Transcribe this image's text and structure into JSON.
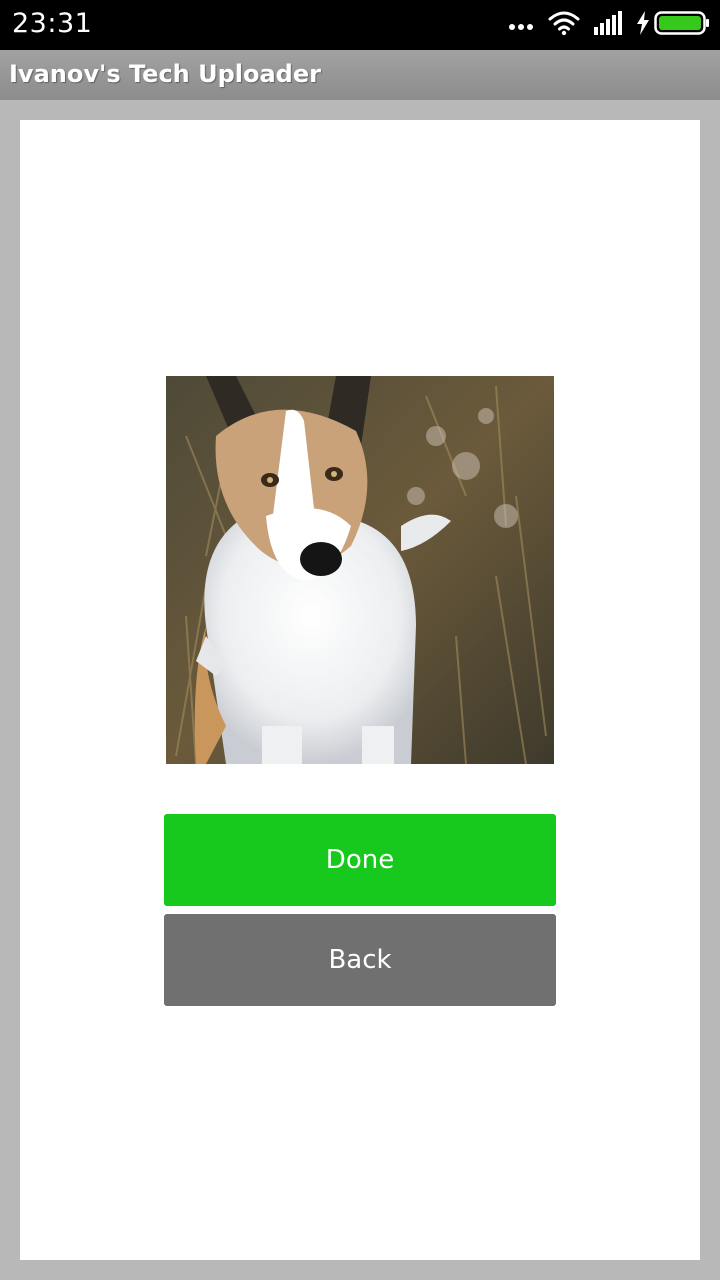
{
  "status_bar": {
    "time": "23:31",
    "icons": [
      "more-dots-icon",
      "wifi-icon",
      "signal-icon",
      "charging-bolt-icon",
      "battery-icon"
    ],
    "battery_color": "#36c81b"
  },
  "app_bar": {
    "title": "Ivanov's Tech Uploader"
  },
  "main": {
    "image_subject": "dog-photo",
    "done_label": "Done",
    "back_label": "Back"
  },
  "colors": {
    "done_button": "#16c91c",
    "back_button": "#707070",
    "app_bar": "#9a9a9a",
    "page_background": "#b8b8b8"
  }
}
